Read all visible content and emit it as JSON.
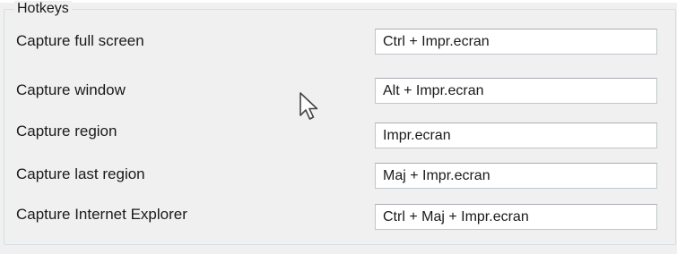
{
  "hotkeys": {
    "title": "Hotkeys",
    "items": [
      {
        "label": "Capture full screen",
        "value": "Ctrl + Impr.ecran"
      },
      {
        "label": "Capture window",
        "value": "Alt + Impr.ecran"
      },
      {
        "label": "Capture region",
        "value": "Impr.ecran"
      },
      {
        "label": "Capture last region",
        "value": "Maj + Impr.ecran"
      },
      {
        "label": "Capture Internet Explorer",
        "value": "Ctrl + Maj + Impr.ecran"
      }
    ]
  },
  "cursor": {
    "icon": "mouse-pointer-icon"
  }
}
